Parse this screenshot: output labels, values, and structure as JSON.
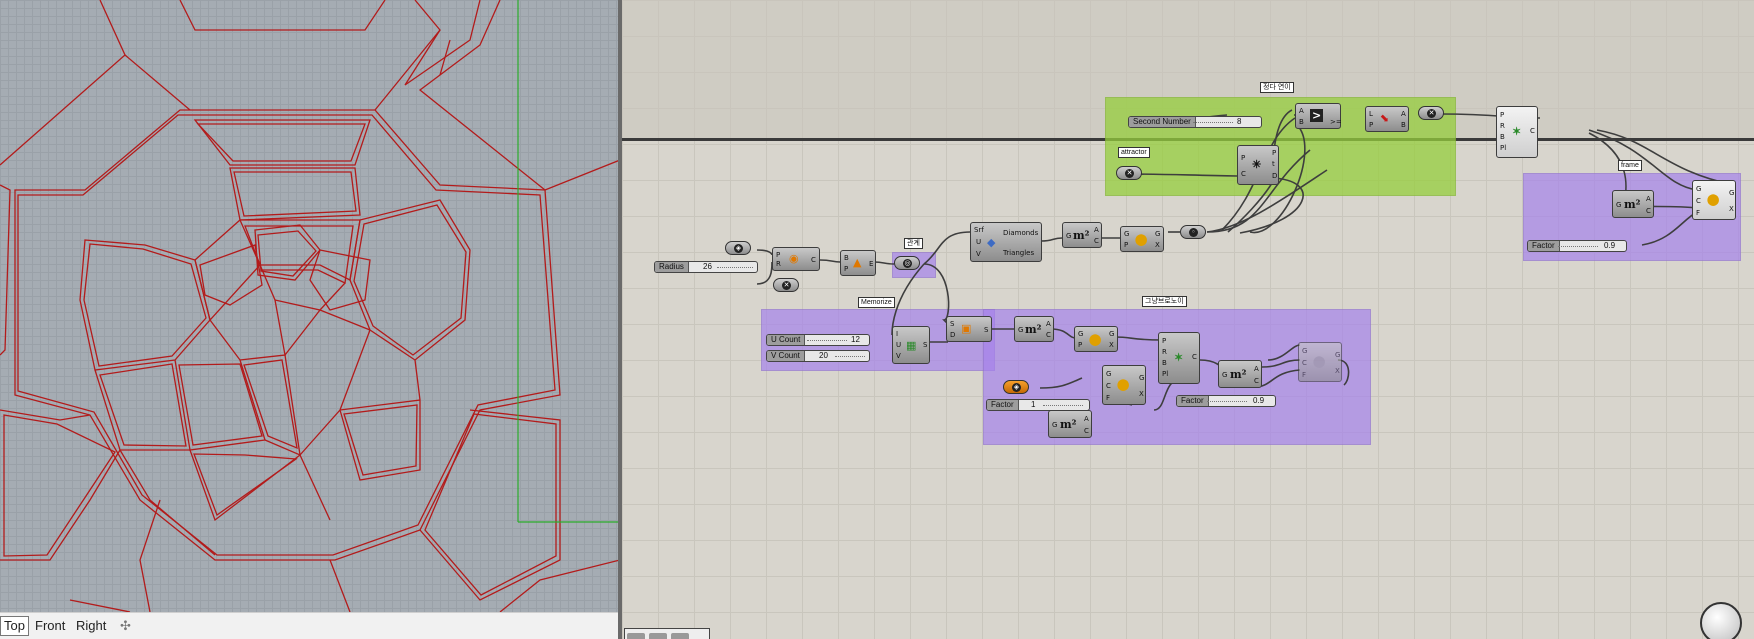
{
  "viewport": {
    "tabs": [
      "Top",
      "Front",
      "Right"
    ],
    "add_tab_icon": "plus-icon",
    "curve_color": "#b31b1b",
    "grid_color": "#a5acb3"
  },
  "canvas": {
    "group_colors": {
      "green": "#96cd3c",
      "purple": "#a582eb"
    },
    "tags": {
      "top_group": "정다 연이",
      "attractor": "attractor",
      "center": "관계",
      "memorize": "Memorize",
      "bottom_group": "그냥브로노이",
      "frame": "frame"
    },
    "sliders": {
      "second_number": {
        "label": "Second Number",
        "value": "8"
      },
      "radius": {
        "label": "Radius",
        "value": "26"
      },
      "u_count": {
        "label": "U Count",
        "value": "12"
      },
      "v_count": {
        "label": "V Count",
        "value": "20"
      },
      "factor_bottom": {
        "label": "Factor",
        "value": "1"
      },
      "factor_mid": {
        "label": "Factor",
        "value": "0.9"
      },
      "factor_right": {
        "label": "Factor",
        "value": "0.9"
      }
    },
    "components": {
      "diamonds": {
        "inputs": [
          "Srf",
          "U",
          "V"
        ],
        "outputs": [
          "Diamonds",
          "Triangles"
        ]
      },
      "compare": {
        "inputs": [
          "A",
          "B"
        ],
        "outputs": [
          "",
          ">="
        ]
      },
      "pull": {
        "inputs": [
          "L",
          "P"
        ],
        "outputs": [
          "A",
          "B"
        ]
      },
      "closest": {
        "inputs": [
          "P",
          "C"
        ],
        "outputs": [
          "P",
          "t",
          "D"
        ]
      },
      "voronoi_top": {
        "inputs": [
          "P",
          "R",
          "B",
          "Pl"
        ],
        "output": "C"
      },
      "voronoi_bottom": {
        "inputs": [
          "P",
          "R",
          "B",
          "Pl"
        ],
        "output": "C"
      },
      "area": {
        "inputs": [
          "G"
        ],
        "outputs": [
          "A",
          "C"
        ]
      },
      "scale": {
        "inputs": [
          "G",
          "C",
          "F"
        ],
        "outputs": [
          "G",
          "X"
        ]
      },
      "move": {
        "inputs": [
          "G",
          "P"
        ],
        "outputs": [
          "G",
          "X"
        ]
      },
      "circle": {
        "inputs": [
          "P",
          "R"
        ],
        "output": "C"
      },
      "brep": {
        "inputs": [
          "B",
          "P"
        ],
        "output": "E"
      },
      "divide": {
        "inputs": [
          "I",
          "U",
          "V"
        ],
        "output": "S"
      },
      "surface": {
        "inputs": [
          "S",
          "D"
        ],
        "output": "S"
      }
    },
    "area_icon": "m²"
  }
}
